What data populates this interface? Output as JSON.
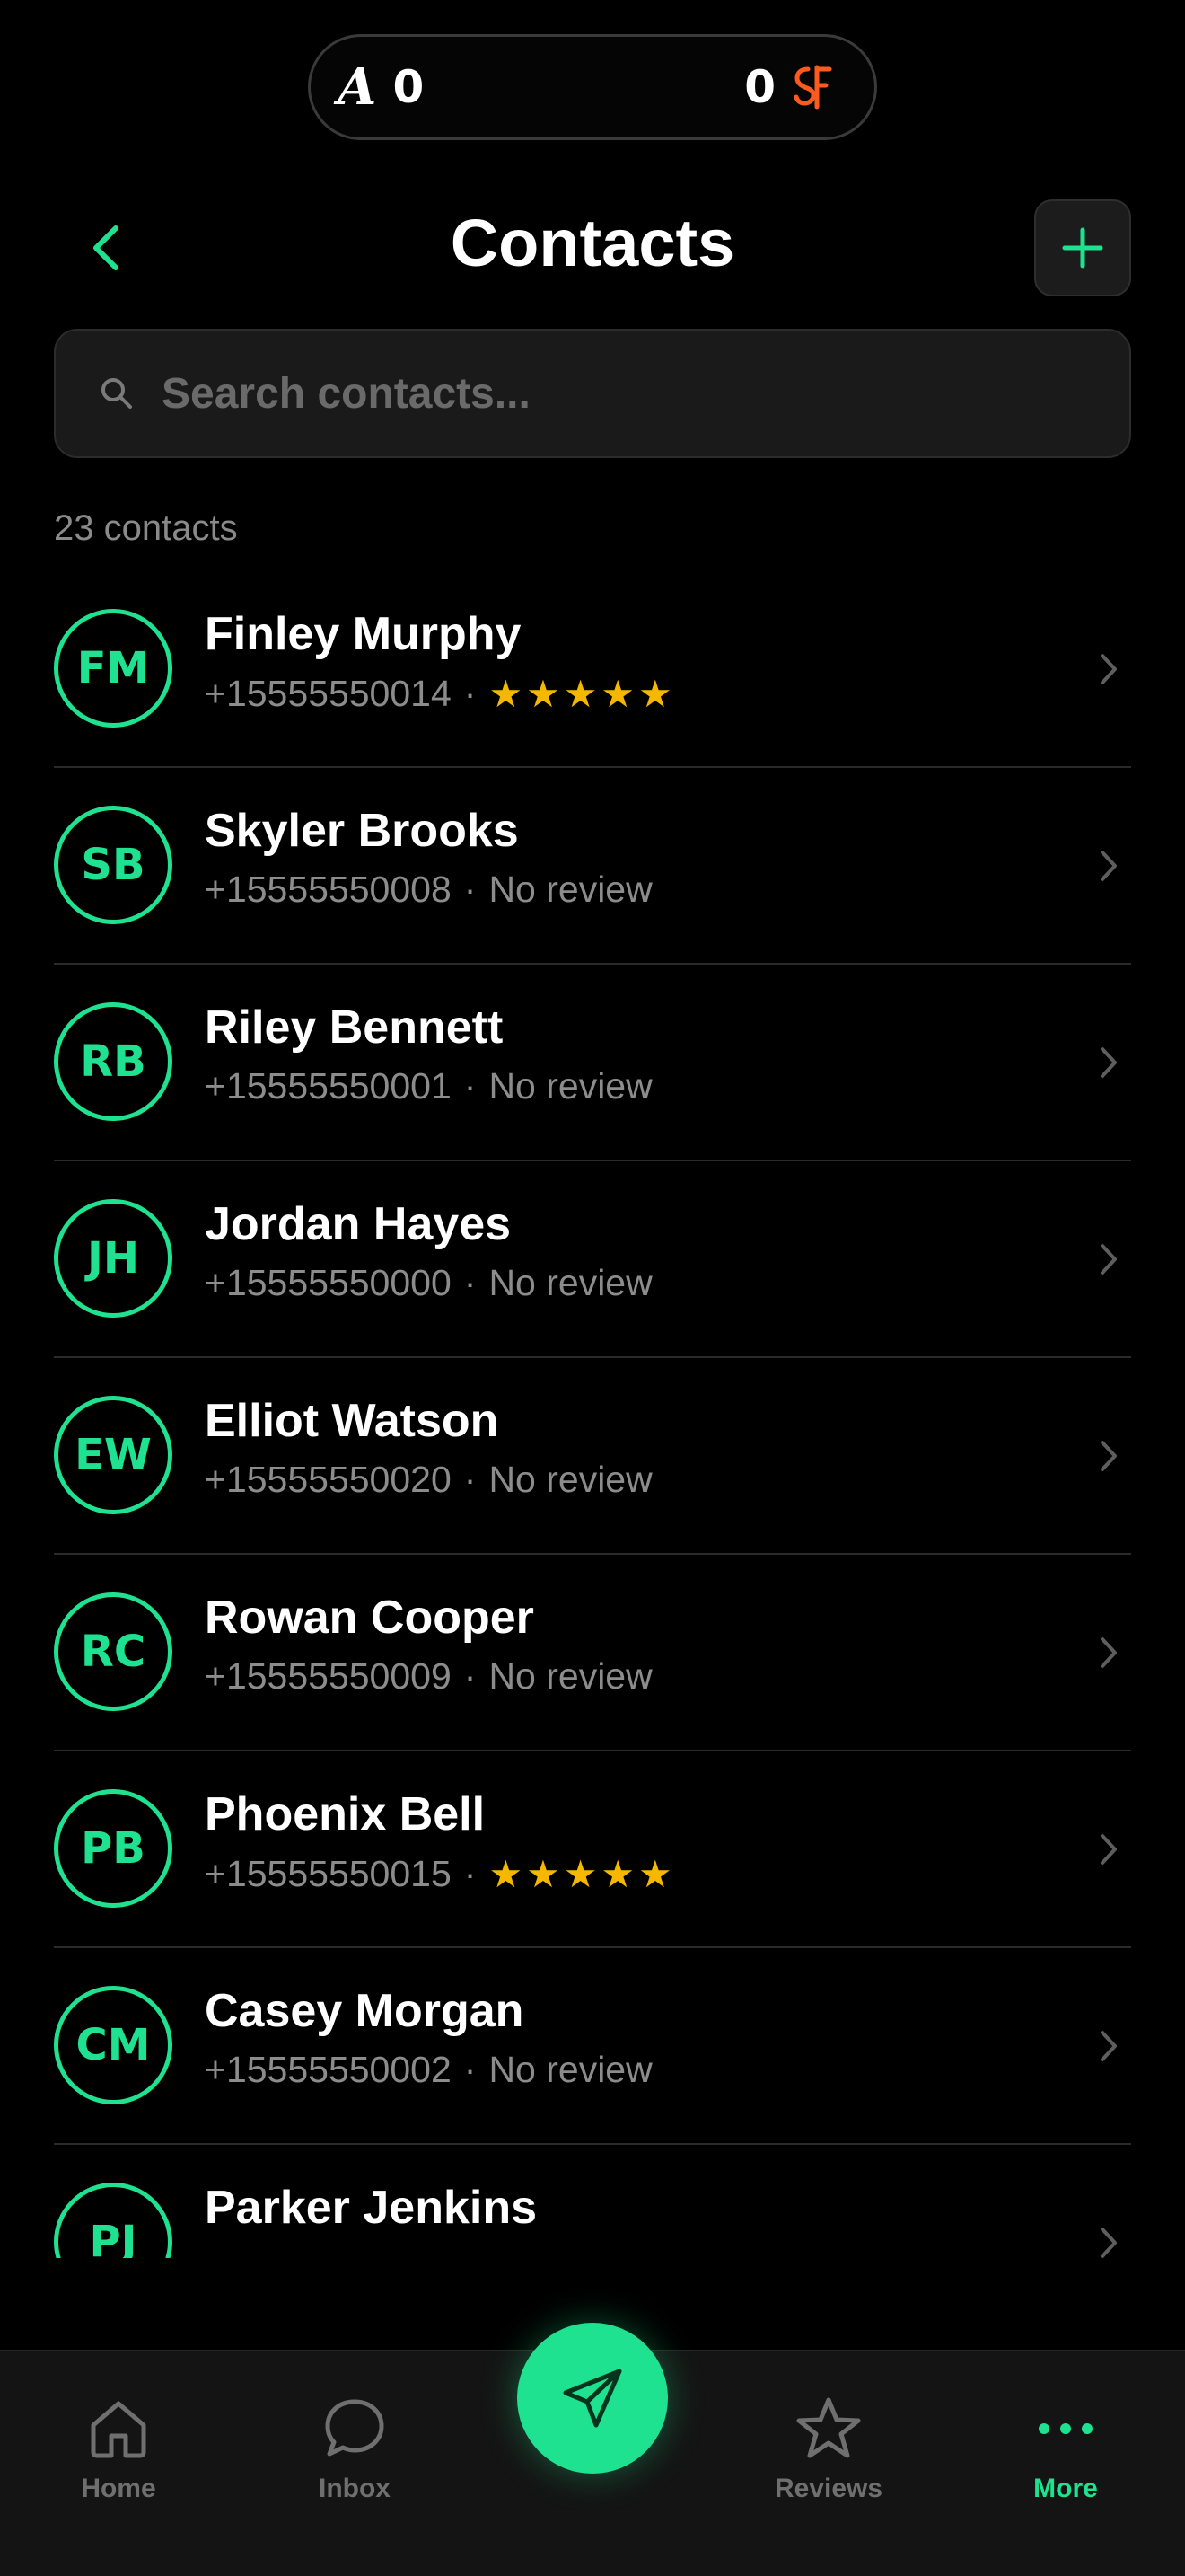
{
  "scoreboard": {
    "away_team_logo": "A",
    "away_score": "0",
    "home_score": "0",
    "home_team_logo": "sf-logo-icon"
  },
  "header": {
    "title": "Contacts",
    "back_icon": "chevron-left-icon",
    "add_icon": "plus-icon"
  },
  "search": {
    "placeholder": "Search contacts...",
    "value": ""
  },
  "contacts_count": "23 contacts",
  "contacts": [
    {
      "initials": "FM",
      "name": "Finley Murphy",
      "phone": "+15555550014",
      "review": "★★★★★",
      "has_review": true
    },
    {
      "initials": "SB",
      "name": "Skyler Brooks",
      "phone": "+15555550008",
      "review": "No review",
      "has_review": false
    },
    {
      "initials": "RB",
      "name": "Riley Bennett",
      "phone": "+15555550001",
      "review": "No review",
      "has_review": false
    },
    {
      "initials": "JH",
      "name": "Jordan Hayes",
      "phone": "+15555550000",
      "review": "No review",
      "has_review": false
    },
    {
      "initials": "EW",
      "name": "Elliot Watson",
      "phone": "+15555550020",
      "review": "No review",
      "has_review": false
    },
    {
      "initials": "RC",
      "name": "Rowan Cooper",
      "phone": "+15555550009",
      "review": "No review",
      "has_review": false
    },
    {
      "initials": "PB",
      "name": "Phoenix Bell",
      "phone": "+15555550015",
      "review": "★★★★★",
      "has_review": true
    },
    {
      "initials": "CM",
      "name": "Casey Morgan",
      "phone": "+15555550002",
      "review": "No review",
      "has_review": false
    },
    {
      "initials": "PJ",
      "name": "Parker Jenkins",
      "phone": "",
      "review": "",
      "has_review": false
    }
  ],
  "separator": "·",
  "bottom_nav": {
    "items": [
      {
        "label": "Home",
        "icon": "home-icon"
      },
      {
        "label": "Inbox",
        "icon": "chat-bubble-icon"
      },
      {
        "label": "Reviews",
        "icon": "star-outline-icon"
      },
      {
        "label": "More",
        "icon": "more-dots-icon"
      }
    ],
    "active": "More",
    "fab_icon": "send-paper-plane-icon"
  },
  "colors": {
    "accent": "#1ee28f",
    "star": "#f5b700",
    "background": "#000000",
    "muted_text": "#8c8c8c",
    "sf_logo": "#fd5a1e"
  }
}
